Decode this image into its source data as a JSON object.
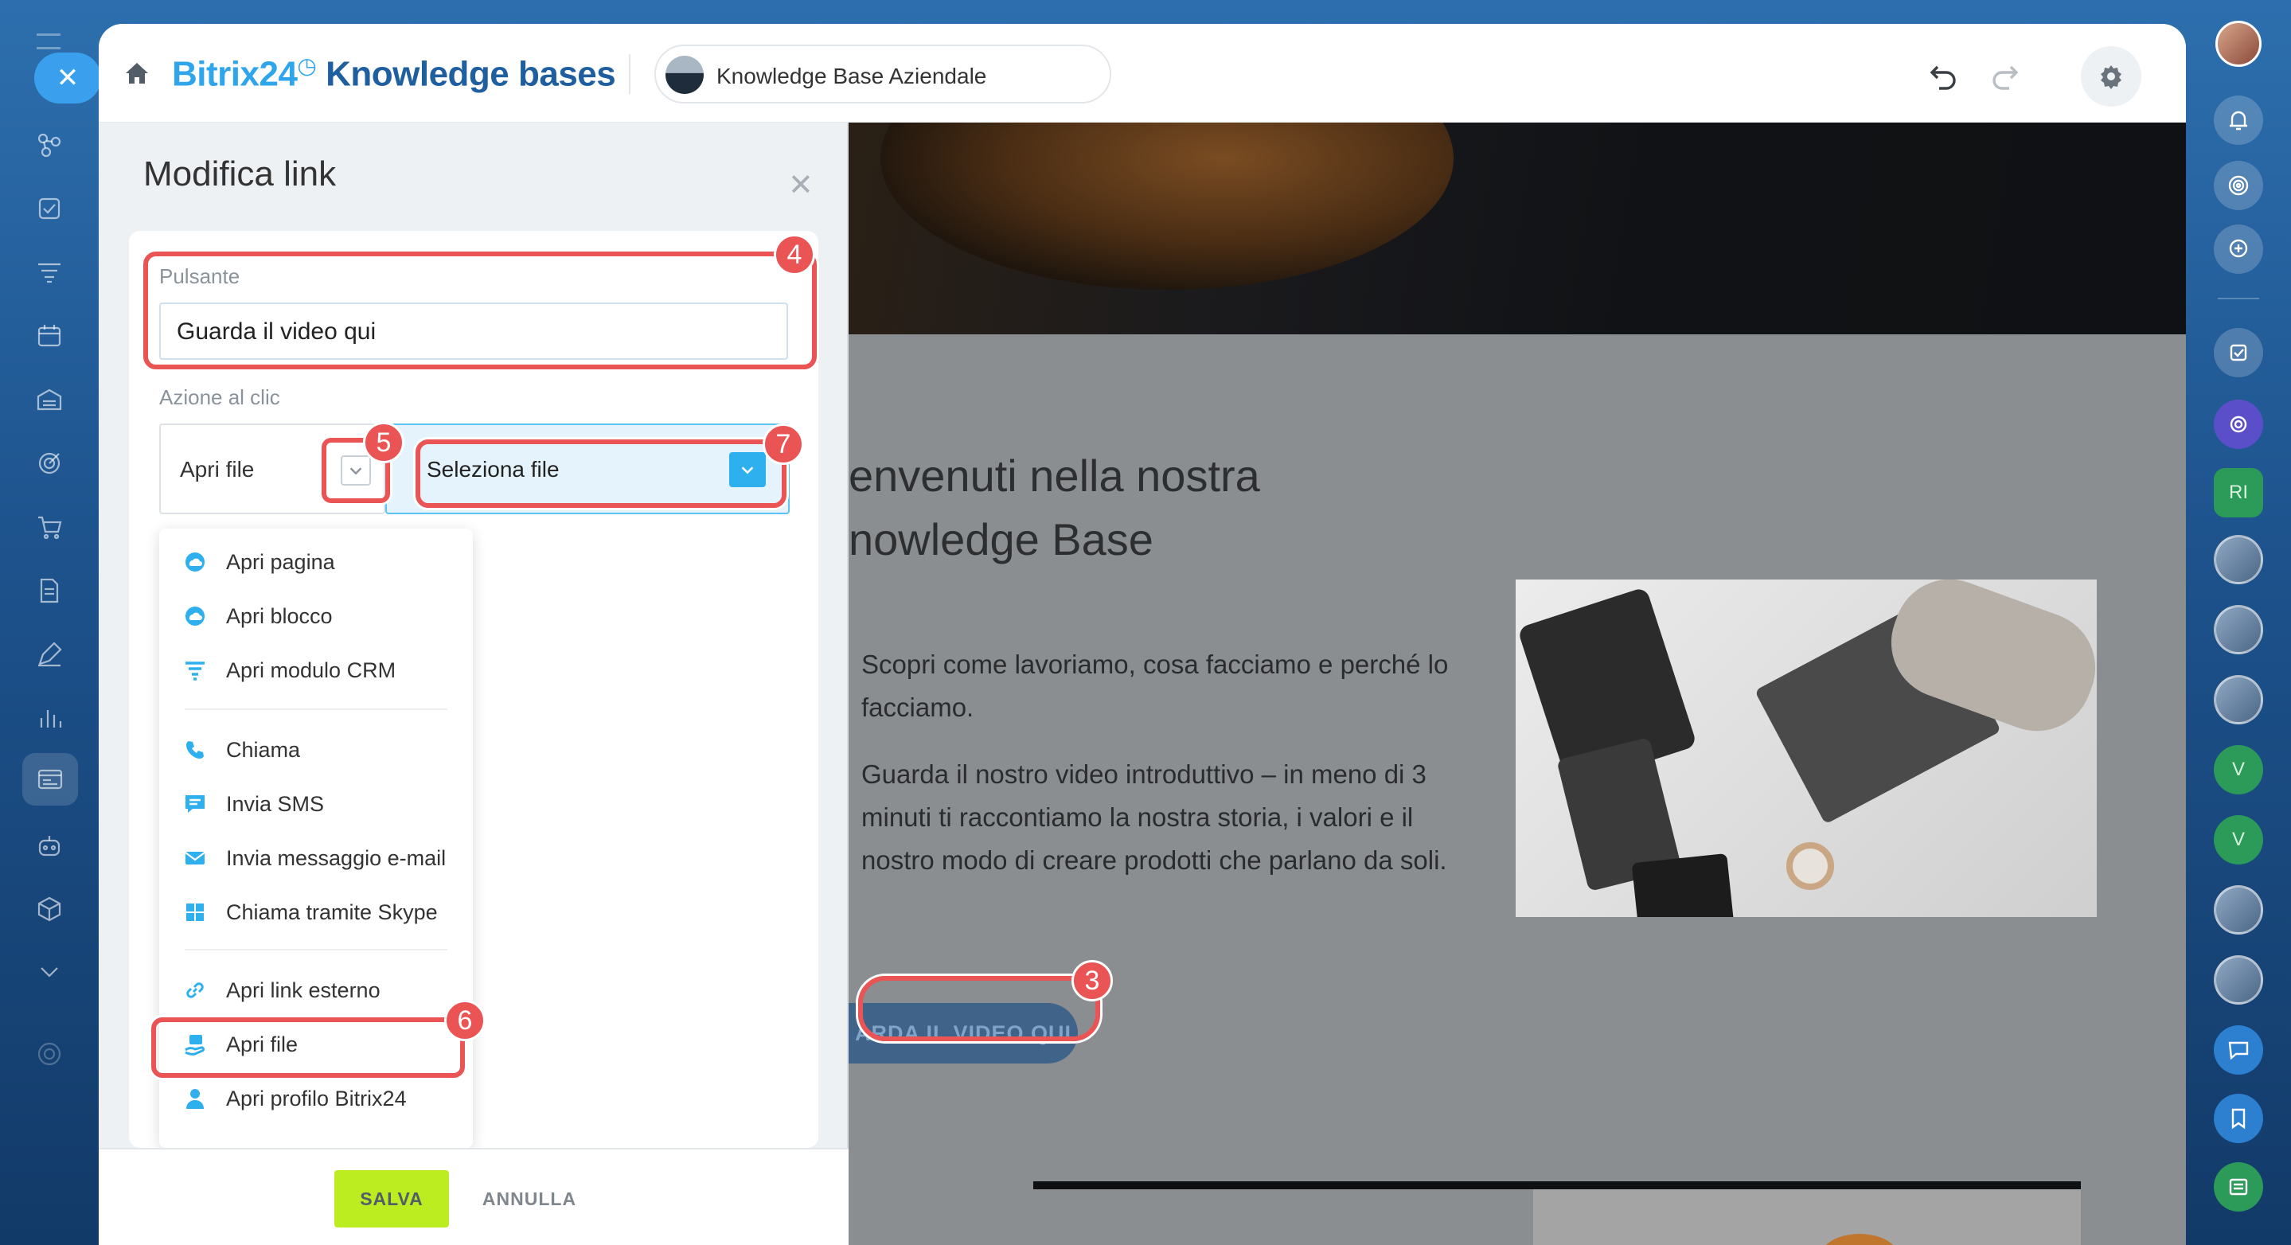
{
  "app": {
    "brand": "Bitrix24",
    "brand_clock": "◷",
    "section": "Knowledge bases",
    "knowledge_base_name": "Knowledge Base Aziendale"
  },
  "panel": {
    "title": "Modifica link",
    "button_label": "Pulsante",
    "button_text_value": "Guarda il video qui",
    "action_label": "Azione al clic",
    "action_selected": "Apri file",
    "file_select": "Seleziona file",
    "save": "SALVA",
    "cancel": "ANNULLA"
  },
  "dropdown": {
    "items": [
      {
        "label": "Apri pagina",
        "icon": "landing-icon"
      },
      {
        "label": "Apri blocco",
        "icon": "landing-icon"
      },
      {
        "label": "Apri modulo CRM",
        "icon": "funnel-icon"
      },
      {
        "label": "Chiama",
        "icon": "phone-icon"
      },
      {
        "label": "Invia SMS",
        "icon": "sms-icon"
      },
      {
        "label": "Invia messaggio e-mail",
        "icon": "mail-icon"
      },
      {
        "label": "Chiama tramite Skype",
        "icon": "grid-icon"
      },
      {
        "label": "Apri link esterno",
        "icon": "link-icon"
      },
      {
        "label": "Apri file",
        "icon": "file-hand-icon"
      },
      {
        "label": "Apri profilo Bitrix24",
        "icon": "user-icon"
      }
    ]
  },
  "preview": {
    "title_line1": "envenuti nella nostra",
    "title_line2": "nowledge Base",
    "para1": "Scopri come lavoriamo, cosa facciamo e perché lo facciamo.",
    "para2": "Guarda il nostro video introduttivo – in meno di 3 minuti ti raccontiamo la nostra storia, i valori e il nostro modo di creare prodotti che parlano da soli.",
    "cta": "ARDA IL VIDEO QUI"
  },
  "right_sidebar": {
    "badge_ri": "RI",
    "badge_v1": "V",
    "badge_v2": "V"
  },
  "annotations": [
    "3",
    "4",
    "5",
    "6",
    "7"
  ],
  "colors": {
    "accent": "#2fa6ec",
    "save_button": "#bbed21",
    "annotation": "#ea5455"
  }
}
